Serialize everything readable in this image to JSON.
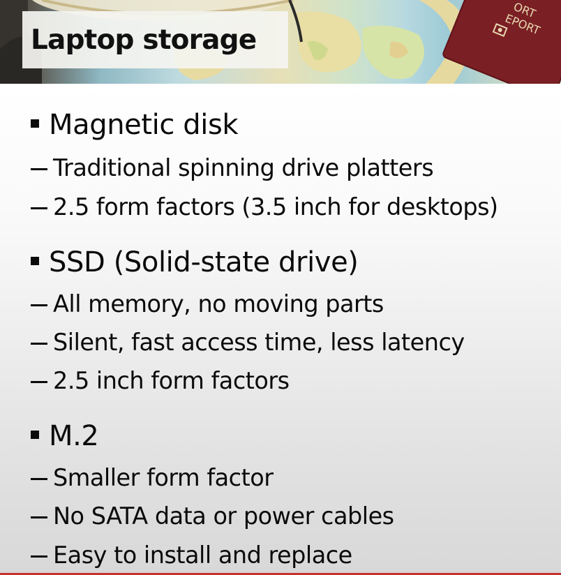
{
  "slide": {
    "title": "Laptop storage",
    "sections": [
      {
        "heading": "Magnetic disk",
        "items": [
          "Traditional spinning drive platters",
          "2.5 form factors (3.5 inch for desktops)"
        ]
      },
      {
        "heading": "SSD (Solid-state drive)",
        "items": [
          "All memory, no moving parts",
          "Silent, fast access time, less latency",
          "2.5 inch form factors"
        ]
      },
      {
        "heading": "M.2",
        "items": [
          "Smaller form factor",
          "No SATA data or power cables",
          "Easy to install and replace"
        ]
      }
    ]
  },
  "banner": {
    "passport_text_line1": "ORT",
    "passport_text_line2": "EPORT",
    "passport_color": "#7a1f24",
    "map_color": "#8fbfca"
  }
}
